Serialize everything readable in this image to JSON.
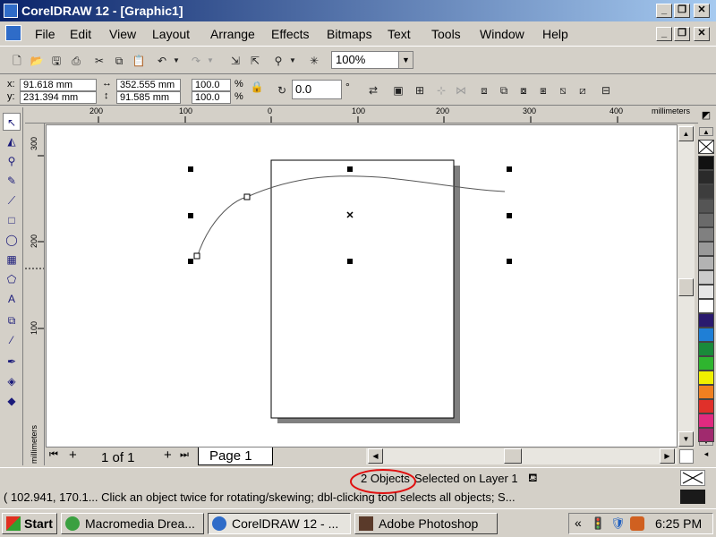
{
  "window": {
    "title": "CorelDRAW 12 - [Graphic1]"
  },
  "menu": {
    "items": [
      "File",
      "Edit",
      "View",
      "Layout",
      "Arrange",
      "Effects",
      "Bitmaps",
      "Text",
      "Tools",
      "Window",
      "Help"
    ]
  },
  "toolbar": {
    "zoom": "100%"
  },
  "propbar": {
    "x_label": "x:",
    "x_value": "91.618 mm",
    "y_label": "y:",
    "y_value": "231.394 mm",
    "width_value": "352.555 mm",
    "height_value": "91.585 mm",
    "scale_w": "100.0",
    "scale_h": "100.0",
    "pct": "%",
    "rotation": "0.0",
    "degree": "°"
  },
  "rulers": {
    "units": "millimeters",
    "h_ticks": [
      "200",
      "100",
      "0",
      "100",
      "200",
      "300",
      "400"
    ],
    "v_ticks": [
      "300",
      "200",
      "100"
    ],
    "v_units": "millimeters"
  },
  "pages": {
    "counter": "1 of 1",
    "current_tab": "Page 1"
  },
  "status": {
    "selection_count": "2 Objects",
    "selection_text": "Selected on Layer 1",
    "hint": "( 102.941, 170.1...  Click an object twice for rotating/skewing; dbl-clicking tool selects all objects; S..."
  },
  "palette_colors": [
    "#111111",
    "#2a2a2a",
    "#3d3d3d",
    "#555555",
    "#6a6a6a",
    "#808080",
    "#999999",
    "#b3b3b3",
    "#cccccc",
    "#e6e6e6",
    "#ffffff",
    "#2a1a6e",
    "#1f7fd6",
    "#1a8a3a",
    "#2fb52f",
    "#f0f000",
    "#f08020",
    "#e0302a",
    "#e02a80",
    "#a02a6e"
  ],
  "taskbar": {
    "start_label": "Start",
    "tasks": [
      "Macromedia Drea...",
      "CorelDRAW 12 - ...",
      "Adobe Photoshop"
    ],
    "clock": "6:25 PM",
    "tray_chevron": "«"
  }
}
